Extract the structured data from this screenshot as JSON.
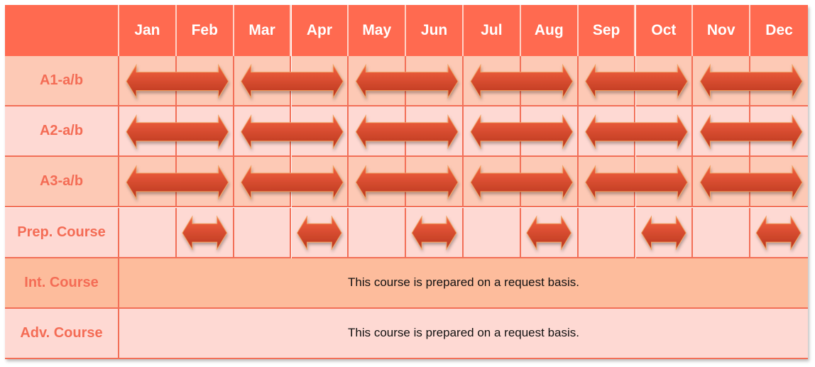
{
  "months": [
    "Jan",
    "Feb",
    "Mar",
    "Apr",
    "May",
    "Jun",
    "Jul",
    "Aug",
    "Sep",
    "Oct",
    "Nov",
    "Dec"
  ],
  "rows": [
    {
      "label": "A1-a/b",
      "type": "bimonthly"
    },
    {
      "label": "A2-a/b",
      "type": "bimonthly"
    },
    {
      "label": "A3-a/b",
      "type": "bimonthly"
    },
    {
      "label": "Prep. Course",
      "type": "monthly-even"
    },
    {
      "label": "Int. Course",
      "type": "note",
      "note": "This course is prepared on a request basis."
    },
    {
      "label": "Adv. Course",
      "type": "note",
      "note": "This course is prepared on a request basis."
    }
  ],
  "schedule": {
    "long_arrow_spans": [
      [
        1,
        2
      ],
      [
        3,
        4
      ],
      [
        5,
        6
      ],
      [
        7,
        8
      ],
      [
        9,
        10
      ],
      [
        11,
        12
      ]
    ],
    "short_arrow_months": [
      2,
      4,
      6,
      8,
      10,
      12
    ]
  },
  "colors": {
    "header_bg": "#ff6a50",
    "grid_line": "#f26f57",
    "row_dark": "#fdc9b5",
    "row_light": "#fed9d3",
    "row_int": "#fdbc9c",
    "label_text": "#f46c55",
    "arrow_top": "#f4613f",
    "arrow_bottom": "#b8361f",
    "arrow_outline": "#f0a060"
  }
}
